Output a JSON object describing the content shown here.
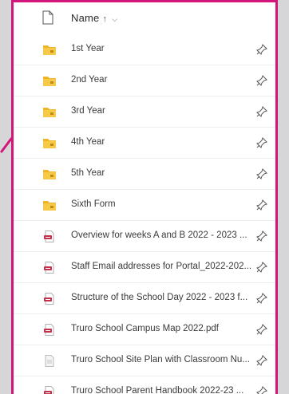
{
  "header": {
    "name_label": "Name",
    "sort_indicator": "↑",
    "chevron": "⌵"
  },
  "files": [
    {
      "name": "1st Year",
      "type": "folder"
    },
    {
      "name": "2nd Year",
      "type": "folder"
    },
    {
      "name": "3rd Year",
      "type": "folder"
    },
    {
      "name": "4th Year",
      "type": "folder"
    },
    {
      "name": "5th Year",
      "type": "folder"
    },
    {
      "name": "Sixth Form",
      "type": "folder"
    },
    {
      "name": "Overview for weeks A and B 2022 - 2023 ...",
      "type": "pdf"
    },
    {
      "name": "Staff Email addresses for Portal_2022-202...",
      "type": "pdf"
    },
    {
      "name": "Structure of the School Day 2022 - 2023 f...",
      "type": "pdf"
    },
    {
      "name": "Truro School Campus Map 2022.pdf",
      "type": "pdf"
    },
    {
      "name": "Truro School Site Plan with Classroom Nu...",
      "type": "image"
    },
    {
      "name": "Truro School Parent Handbook 2022-23 ...",
      "type": "pdf"
    }
  ],
  "colors": {
    "accent_border": "#d4157c",
    "folder": "#f0b429",
    "pdf": "#c4314b"
  },
  "icons": {
    "header": "document-icon",
    "folder": "folder-icon",
    "pdf": "pdf-file-icon",
    "image": "image-file-icon",
    "pin": "pin-icon"
  }
}
